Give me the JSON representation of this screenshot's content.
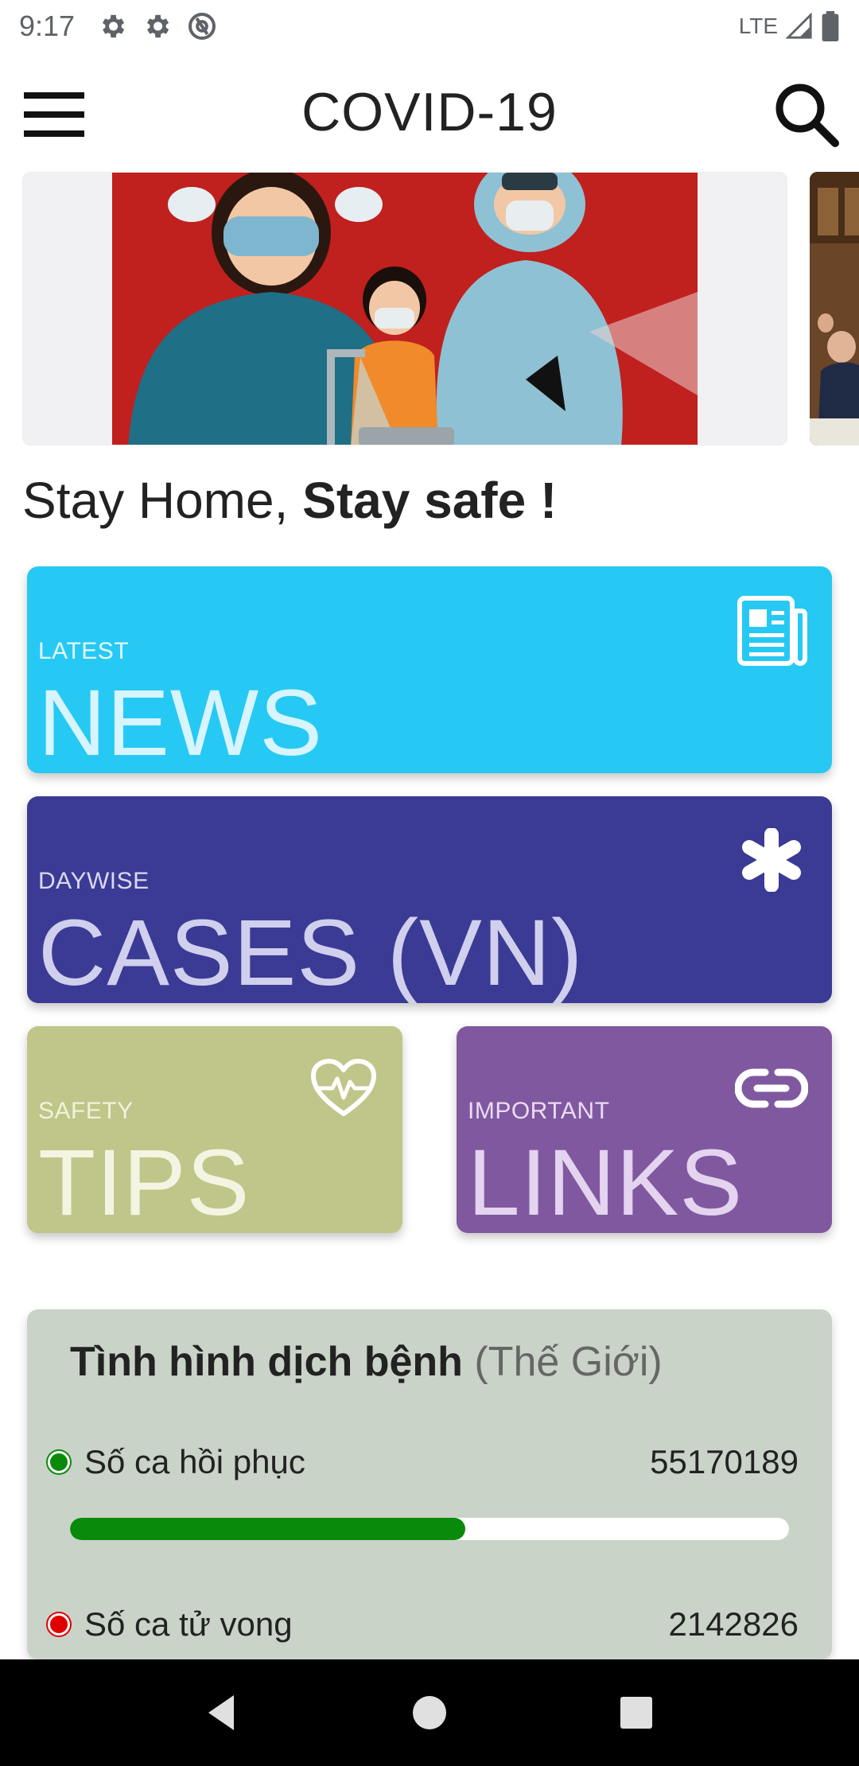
{
  "status_bar": {
    "time": "9:17",
    "network": "LTE"
  },
  "app_bar": {
    "title": "COVID-19"
  },
  "tagline": {
    "normal": "Stay Home, ",
    "bold": "Stay safe !"
  },
  "tiles": {
    "news": {
      "eyebrow": "LATEST",
      "title": "NEWS",
      "icon": "newspaper-icon",
      "color": "#26c9f3"
    },
    "cases": {
      "eyebrow": "DAYWISE",
      "title": "CASES (VN)",
      "icon": "asterisk-icon",
      "color": "#3b3a94"
    },
    "tips": {
      "eyebrow": "SAFETY",
      "title": "TIPS",
      "icon": "heartbeat-icon",
      "color": "#c0c689"
    },
    "links": {
      "eyebrow": "IMPORTANT",
      "title": "LINKS",
      "icon": "link-icon",
      "color": "#8058a0"
    }
  },
  "stats": {
    "heading": "Tình hình dịch bệnh",
    "scope": "(Thế Giới)",
    "recovered": {
      "label": "Số ca hồi phục",
      "value": "55170189",
      "fraction": 0.55,
      "color": "#0a8a0a"
    },
    "deaths": {
      "label": "Số ca tử vong",
      "value": "2142826",
      "color": "#e00000"
    }
  }
}
